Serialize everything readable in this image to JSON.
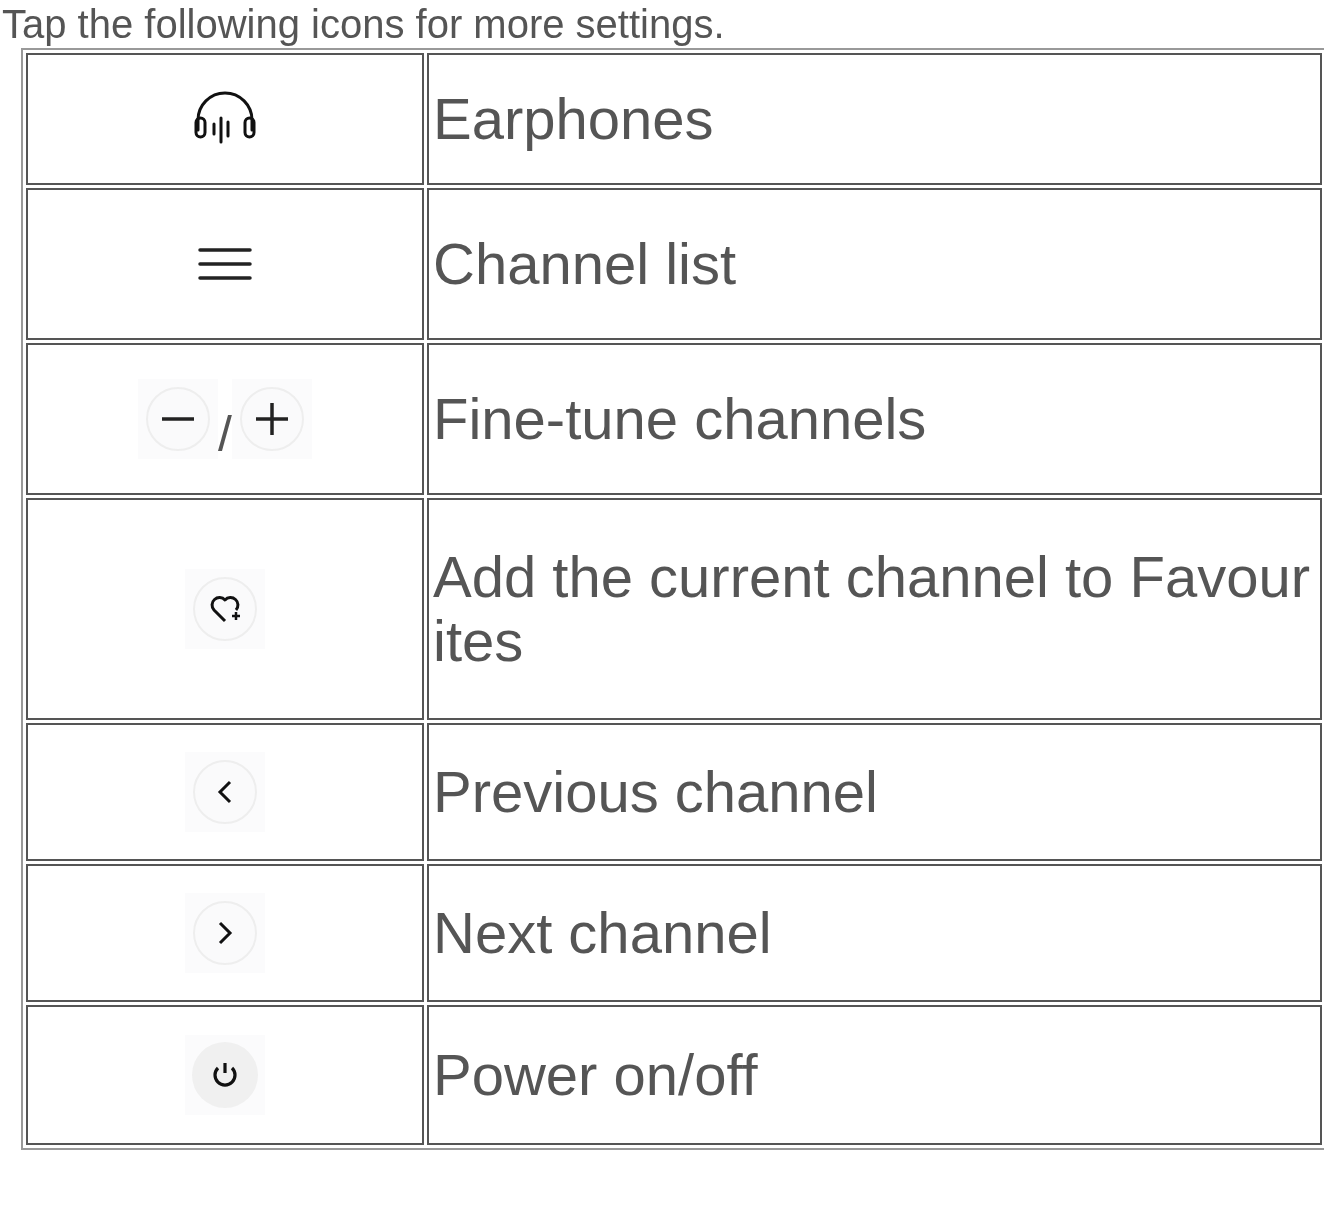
{
  "intro": "Tap the following icons for more settings.",
  "rows": [
    {
      "kind": "headphones",
      "label": "Earphones"
    },
    {
      "kind": "menu",
      "label": "Channel list"
    },
    {
      "kind": "minus-plus",
      "separator": "/",
      "label": "Fine-tune channels"
    },
    {
      "kind": "heart-add",
      "label": "Add the current channel to Favourites"
    },
    {
      "kind": "prev",
      "label": "Previous channel"
    },
    {
      "kind": "next",
      "label": "Next channel"
    },
    {
      "kind": "power",
      "label": "Power on/off"
    }
  ]
}
